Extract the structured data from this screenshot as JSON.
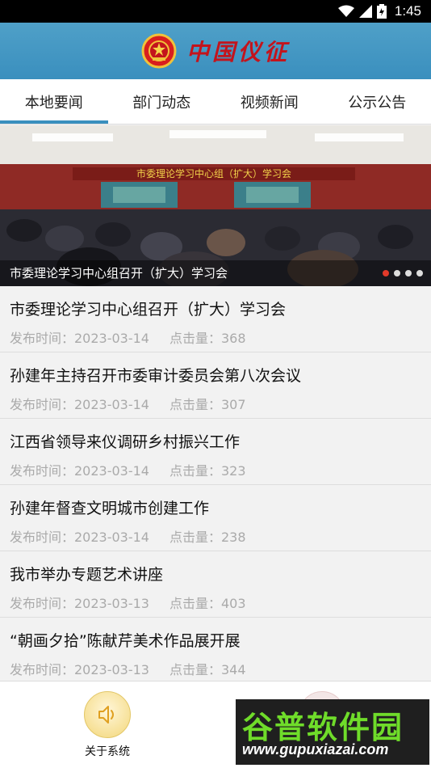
{
  "status_bar": {
    "time": "1:45"
  },
  "header": {
    "title": "中国仪征"
  },
  "tabs": [
    {
      "label": "本地要闻",
      "active": true
    },
    {
      "label": "部门动态",
      "active": false
    },
    {
      "label": "视频新闻",
      "active": false
    },
    {
      "label": "公示公告",
      "active": false
    }
  ],
  "banner": {
    "caption": "市委理论学习中心组召开（扩大）学习会",
    "screen_text": "市委理论学习中心组（扩大）学习会",
    "slide_count": 4,
    "active_slide": 1
  },
  "news": [
    {
      "title": "市委理论学习中心组召开（扩大）学习会",
      "date_label": "发布时间：2023-03-14",
      "clicks_label": "点击量：368"
    },
    {
      "title": "孙建年主持召开市委审计委员会第八次会议",
      "date_label": "发布时间：2023-03-14",
      "clicks_label": "点击量：307"
    },
    {
      "title": "江西省领导来仪调研乡村振兴工作",
      "date_label": "发布时间：2023-03-14",
      "clicks_label": "点击量：323"
    },
    {
      "title": "孙建年督查文明城市创建工作",
      "date_label": "发布时间：2023-03-14",
      "clicks_label": "点击量：238"
    },
    {
      "title": "我市举办专题艺术讲座",
      "date_label": "发布时间：2023-03-13",
      "clicks_label": "点击量：403"
    },
    {
      "title": "“朝画夕拾”陈献芹美术作品展开展",
      "date_label": "发布时间：2023-03-13",
      "clicks_label": "点击量：344"
    }
  ],
  "bottom_nav": {
    "about_label": "关于系统"
  },
  "watermark": {
    "main": "谷普软件园",
    "url": "www.gupuxiazai.com"
  },
  "colors": {
    "header": "#3a8fbe",
    "accent": "#3a8fbe",
    "emblem_red": "#c3141c"
  }
}
